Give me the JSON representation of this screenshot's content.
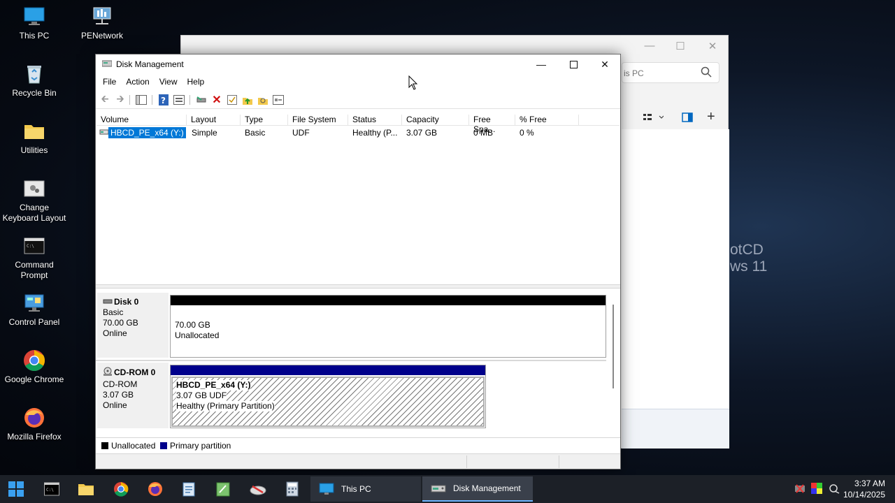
{
  "desktop": {
    "icons": [
      {
        "label": "This PC",
        "icon": "monitor-icon"
      },
      {
        "label": "PENetwork",
        "icon": "network-icon"
      },
      {
        "label": "Recycle Bin",
        "icon": "recycle-bin-icon"
      },
      {
        "label": "Utilities",
        "icon": "folder-icon"
      },
      {
        "label": "Change Keyboard Layout",
        "icon": "keyboard-settings-icon"
      },
      {
        "label": "Command Prompt",
        "icon": "terminal-icon"
      },
      {
        "label": "Control Panel",
        "icon": "control-panel-icon"
      },
      {
        "label": "Google Chrome",
        "icon": "chrome-icon"
      },
      {
        "label": "Mozilla Firefox",
        "icon": "firefox-icon"
      }
    ],
    "wallpaper_text": [
      "otCD",
      "ws 11"
    ]
  },
  "back_window": {
    "search_placeholder": "is PC"
  },
  "disk_management": {
    "title": "Disk Management",
    "menu": [
      "File",
      "Action",
      "View",
      "Help"
    ],
    "columns": [
      "Volume",
      "Layout",
      "Type",
      "File System",
      "Status",
      "Capacity",
      "Free Spa...",
      "% Free"
    ],
    "rows": [
      {
        "volume": "HBCD_PE_x64 (Y:)",
        "layout": "Simple",
        "type": "Basic",
        "fs": "UDF",
        "status": "Healthy (P...",
        "capacity": "3.07 GB",
        "free": "0 MB",
        "pct_free": "0 %"
      }
    ],
    "disks": [
      {
        "name": "Disk 0",
        "type": "Basic",
        "size": "70.00 GB",
        "state": "Online",
        "partition": {
          "size": "70.00 GB",
          "desc": "Unallocated"
        }
      },
      {
        "name": "CD-ROM 0",
        "type": "CD-ROM",
        "size": "3.07 GB",
        "state": "Online",
        "partition": {
          "name": "HBCD_PE_x64  (Y:)",
          "size": "3.07 GB UDF",
          "desc": "Healthy (Primary Partition)"
        }
      }
    ],
    "legend": [
      {
        "label": "Unallocated",
        "color": "#000000"
      },
      {
        "label": "Primary partition",
        "color": "#00008b"
      }
    ]
  },
  "taskbar": {
    "apps": [
      {
        "label": "This PC"
      },
      {
        "label": "Disk Management"
      }
    ],
    "time": "3:37 AM",
    "date": "10/14/2025"
  },
  "colors": {
    "selection": "#0078d7",
    "primary_partition": "#00008b",
    "taskbar": "#1c2027"
  }
}
